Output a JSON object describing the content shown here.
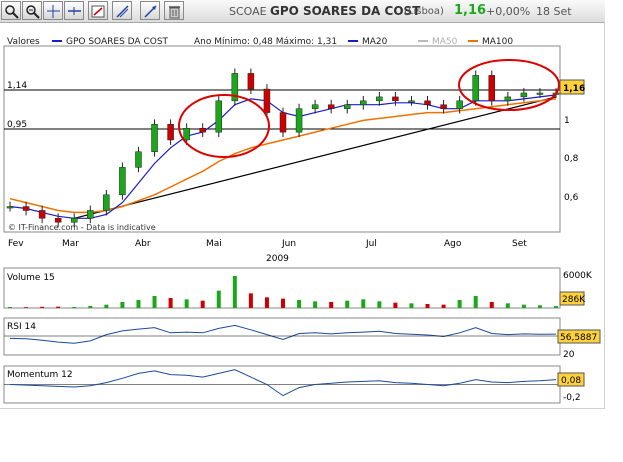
{
  "toolbar": {
    "buttons": [
      "zoom-in-icon",
      "zoom-out-icon",
      "crosshair-icon",
      "text-annotation-icon",
      "trend-line-icon",
      "pan-icon",
      "delete-icon"
    ]
  },
  "header": {
    "ticker": "SCOAE",
    "name": "GPO SOARES DA COST",
    "market": "(Lisboa)",
    "price": "1,16",
    "change": "+0,00%",
    "date": "18 Set"
  },
  "legend": {
    "label": "Valores",
    "series_name": "GPO SOARES DA COST",
    "range_text": "Ano Mínimo: 0,48 Máximo: 1,31",
    "ma20": "MA20",
    "ma50": "MA50",
    "ma100": "MA100"
  },
  "colors": {
    "up": "#1aa81a",
    "down": "#cc0000",
    "ma20": "#1c1cc8",
    "ma50": "#b9b9b9",
    "ma100": "#f07000",
    "trend": "#000000",
    "ellipse": "#dd0000",
    "price_badge": "#ffd23a",
    "rsi_line": "#1a4a9a",
    "momentum_line": "#1a4a9a",
    "volume_ma": "#cc0000"
  },
  "watermark": "© IT-Finance.com - Data is indicative",
  "chart_data": [
    {
      "type": "line",
      "panel": "price",
      "x": [
        "Fev",
        "Mar",
        "Abr",
        "Mai",
        "Jun",
        "Jul",
        "Ago",
        "Set"
      ],
      "year": "2009",
      "y_ticks": [
        "1",
        "0,8",
        "0,6"
      ],
      "ref_lines": [
        1.14,
        0.95
      ],
      "ref_labels": [
        "1,14",
        "0,95"
      ],
      "ylim": [
        0.45,
        1.4
      ],
      "last_price_label": "1,16",
      "series": [
        {
          "name": "GPO SOARES DA COST",
          "values": [
            0.58,
            0.56,
            0.52,
            0.5,
            0.52,
            0.56,
            0.64,
            0.78,
            0.86,
            1.0,
            0.92,
            0.98,
            0.96,
            1.12,
            1.26,
            1.18,
            1.06,
            0.96,
            1.08,
            1.1,
            1.08,
            1.1,
            1.12,
            1.14,
            1.12,
            1.12,
            1.1,
            1.08,
            1.12,
            1.25,
            1.12,
            1.14,
            1.16,
            1.16,
            1.16
          ]
        },
        {
          "name": "MA20",
          "values": [
            0.58,
            0.57,
            0.55,
            0.53,
            0.52,
            0.52,
            0.54,
            0.6,
            0.7,
            0.8,
            0.88,
            0.94,
            0.96,
            1.02,
            1.1,
            1.13,
            1.12,
            1.06,
            1.04,
            1.06,
            1.08,
            1.1,
            1.1,
            1.1,
            1.11,
            1.11,
            1.1,
            1.08,
            1.08,
            1.12,
            1.12,
            1.12,
            1.13,
            1.14,
            1.15
          ]
        },
        {
          "name": "MA100",
          "values": [
            0.62,
            0.6,
            0.58,
            0.56,
            0.55,
            0.55,
            0.56,
            0.58,
            0.61,
            0.64,
            0.68,
            0.72,
            0.76,
            0.81,
            0.85,
            0.88,
            0.9,
            0.92,
            0.94,
            0.96,
            0.98,
            1.0,
            1.02,
            1.03,
            1.04,
            1.05,
            1.06,
            1.06,
            1.07,
            1.08,
            1.09,
            1.1,
            1.11,
            1.12,
            1.13
          ]
        }
      ]
    },
    {
      "type": "bar",
      "panel": "volume",
      "title": "Volume 15",
      "y_ticks": [
        "6000K"
      ],
      "last_value_label": "286K",
      "ylim": [
        0,
        6000
      ],
      "values": [
        150,
        120,
        180,
        200,
        160,
        300,
        500,
        900,
        1200,
        1800,
        1500,
        1300,
        1100,
        2600,
        4800,
        2200,
        1600,
        1400,
        1200,
        1000,
        900,
        1100,
        1300,
        1000,
        800,
        700,
        600,
        500,
        1200,
        1800,
        900,
        700,
        500,
        400,
        286
      ]
    },
    {
      "type": "line",
      "panel": "rsi",
      "title": "RSI 14",
      "y_ticks": [
        "20"
      ],
      "last_value_label": "56,5887",
      "ylim": [
        0,
        100
      ],
      "values": [
        45,
        44,
        40,
        35,
        32,
        38,
        55,
        65,
        70,
        74,
        60,
        62,
        60,
        72,
        80,
        68,
        55,
        42,
        58,
        60,
        57,
        60,
        62,
        64,
        58,
        56,
        54,
        50,
        60,
        74,
        58,
        55,
        57,
        56,
        56.6
      ]
    },
    {
      "type": "line",
      "panel": "momentum",
      "title": "Momentum 12",
      "y_ticks": [
        "-0,2"
      ],
      "last_value_label": "0,08",
      "ylim": [
        -0.3,
        0.3
      ],
      "values": [
        0.0,
        -0.01,
        -0.02,
        -0.03,
        -0.04,
        -0.02,
        0.03,
        0.1,
        0.18,
        0.22,
        0.16,
        0.15,
        0.12,
        0.18,
        0.24,
        0.12,
        0.0,
        -0.18,
        -0.05,
        0.0,
        0.02,
        0.04,
        0.05,
        0.06,
        0.03,
        0.02,
        0.0,
        -0.02,
        0.02,
        0.08,
        0.04,
        0.03,
        0.05,
        0.06,
        0.08
      ]
    }
  ]
}
